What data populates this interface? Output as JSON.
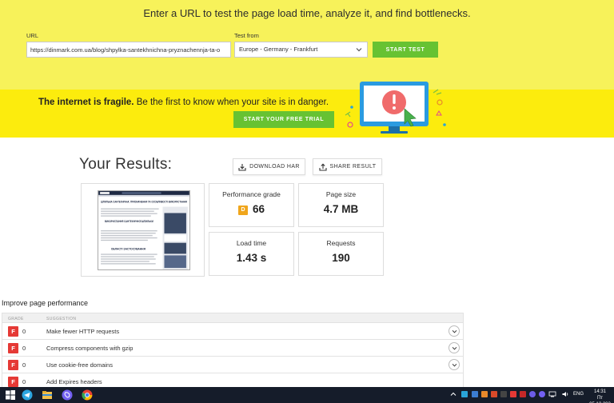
{
  "header": {
    "heading": "Enter a URL to test the page load time, analyze it, and find bottlenecks.",
    "url_label": "URL",
    "url_value": "https://dinmark.com.ua/blog/shpylka-santekhnichna-pryznachennja-ta-o",
    "test_from_label": "Test from",
    "test_from_value": "Europe - Germany - Frankfurt",
    "start_button": "START TEST"
  },
  "banner": {
    "bold_text": "The internet is fragile.",
    "text": " Be the first to know when your site is in danger.",
    "trial_button": "START YOUR FREE TRIAL"
  },
  "results": {
    "title": "Your Results:",
    "download_har": "DOWNLOAD HAR",
    "share_result": "SHARE RESULT",
    "preview": {
      "heading": "ШПИЛЬКА САНТЕХНІЧНА: ПРИЗНАЧЕННЯ ТА ОСОБЛИВОСТІ ВИКОРИСТАННЯ",
      "subheading": "ВИКОРИСТАННЯ САНТЕХНІЧНОЇ ШПИЛЬКИ",
      "section": "ОБЛАСТІ ЗАСТОСУВАННЯ"
    },
    "metrics": {
      "performance_grade_label": "Performance grade",
      "performance_grade_letter": "D",
      "performance_grade_value": "66",
      "page_size_label": "Page size",
      "page_size_value": "4.7 MB",
      "load_time_label": "Load time",
      "load_time_value": "1.43 s",
      "requests_label": "Requests",
      "requests_value": "190"
    }
  },
  "improve": {
    "title": "Improve page performance",
    "col_grade": "GRADE",
    "col_suggestion": "SUGGESTION",
    "rows": [
      {
        "grade": "F",
        "score": "0",
        "suggestion": "Make fewer HTTP requests"
      },
      {
        "grade": "F",
        "score": "0",
        "suggestion": "Compress components with gzip"
      },
      {
        "grade": "F",
        "score": "0",
        "suggestion": "Use cookie-free domains"
      },
      {
        "grade": "F",
        "score": "0",
        "suggestion": "Add Expires headers"
      }
    ]
  },
  "taskbar": {
    "lang": "ENG",
    "time": "14:31",
    "date": "Пт 05.12.202"
  },
  "colors": {
    "top_bg": "#f7f25a",
    "banner_bg": "#fcec0d",
    "accent_green": "#67c232",
    "grade_d": "#f0a61c",
    "grade_f": "#e53935",
    "taskbar": "#151c2a"
  }
}
